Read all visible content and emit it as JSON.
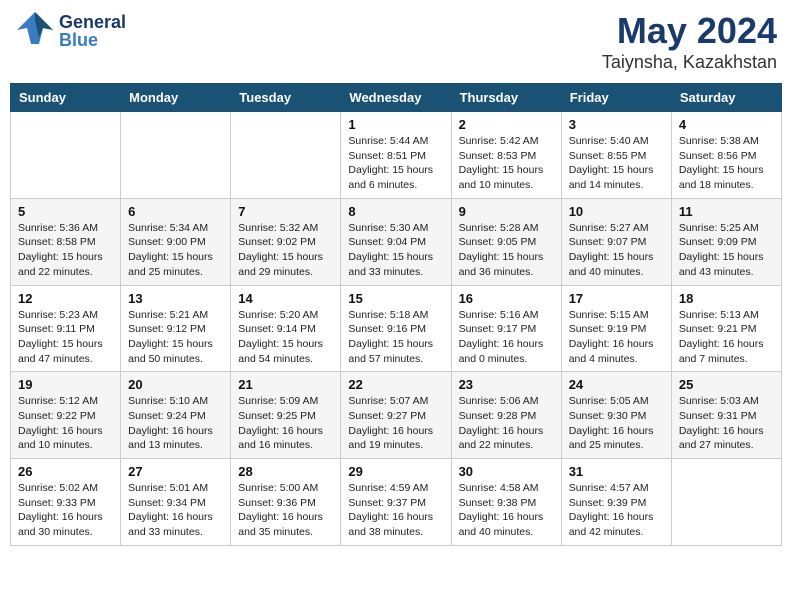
{
  "header": {
    "logo_general": "General",
    "logo_blue": "Blue",
    "month": "May 2024",
    "location": "Taiynsha, Kazakhstan"
  },
  "days_of_week": [
    "Sunday",
    "Monday",
    "Tuesday",
    "Wednesday",
    "Thursday",
    "Friday",
    "Saturday"
  ],
  "weeks": [
    [
      {
        "day": "",
        "sunrise": "",
        "sunset": "",
        "daylight": ""
      },
      {
        "day": "",
        "sunrise": "",
        "sunset": "",
        "daylight": ""
      },
      {
        "day": "",
        "sunrise": "",
        "sunset": "",
        "daylight": ""
      },
      {
        "day": "1",
        "sunrise": "Sunrise: 5:44 AM",
        "sunset": "Sunset: 8:51 PM",
        "daylight": "Daylight: 15 hours and 6 minutes."
      },
      {
        "day": "2",
        "sunrise": "Sunrise: 5:42 AM",
        "sunset": "Sunset: 8:53 PM",
        "daylight": "Daylight: 15 hours and 10 minutes."
      },
      {
        "day": "3",
        "sunrise": "Sunrise: 5:40 AM",
        "sunset": "Sunset: 8:55 PM",
        "daylight": "Daylight: 15 hours and 14 minutes."
      },
      {
        "day": "4",
        "sunrise": "Sunrise: 5:38 AM",
        "sunset": "Sunset: 8:56 PM",
        "daylight": "Daylight: 15 hours and 18 minutes."
      }
    ],
    [
      {
        "day": "5",
        "sunrise": "Sunrise: 5:36 AM",
        "sunset": "Sunset: 8:58 PM",
        "daylight": "Daylight: 15 hours and 22 minutes."
      },
      {
        "day": "6",
        "sunrise": "Sunrise: 5:34 AM",
        "sunset": "Sunset: 9:00 PM",
        "daylight": "Daylight: 15 hours and 25 minutes."
      },
      {
        "day": "7",
        "sunrise": "Sunrise: 5:32 AM",
        "sunset": "Sunset: 9:02 PM",
        "daylight": "Daylight: 15 hours and 29 minutes."
      },
      {
        "day": "8",
        "sunrise": "Sunrise: 5:30 AM",
        "sunset": "Sunset: 9:04 PM",
        "daylight": "Daylight: 15 hours and 33 minutes."
      },
      {
        "day": "9",
        "sunrise": "Sunrise: 5:28 AM",
        "sunset": "Sunset: 9:05 PM",
        "daylight": "Daylight: 15 hours and 36 minutes."
      },
      {
        "day": "10",
        "sunrise": "Sunrise: 5:27 AM",
        "sunset": "Sunset: 9:07 PM",
        "daylight": "Daylight: 15 hours and 40 minutes."
      },
      {
        "day": "11",
        "sunrise": "Sunrise: 5:25 AM",
        "sunset": "Sunset: 9:09 PM",
        "daylight": "Daylight: 15 hours and 43 minutes."
      }
    ],
    [
      {
        "day": "12",
        "sunrise": "Sunrise: 5:23 AM",
        "sunset": "Sunset: 9:11 PM",
        "daylight": "Daylight: 15 hours and 47 minutes."
      },
      {
        "day": "13",
        "sunrise": "Sunrise: 5:21 AM",
        "sunset": "Sunset: 9:12 PM",
        "daylight": "Daylight: 15 hours and 50 minutes."
      },
      {
        "day": "14",
        "sunrise": "Sunrise: 5:20 AM",
        "sunset": "Sunset: 9:14 PM",
        "daylight": "Daylight: 15 hours and 54 minutes."
      },
      {
        "day": "15",
        "sunrise": "Sunrise: 5:18 AM",
        "sunset": "Sunset: 9:16 PM",
        "daylight": "Daylight: 15 hours and 57 minutes."
      },
      {
        "day": "16",
        "sunrise": "Sunrise: 5:16 AM",
        "sunset": "Sunset: 9:17 PM",
        "daylight": "Daylight: 16 hours and 0 minutes."
      },
      {
        "day": "17",
        "sunrise": "Sunrise: 5:15 AM",
        "sunset": "Sunset: 9:19 PM",
        "daylight": "Daylight: 16 hours and 4 minutes."
      },
      {
        "day": "18",
        "sunrise": "Sunrise: 5:13 AM",
        "sunset": "Sunset: 9:21 PM",
        "daylight": "Daylight: 16 hours and 7 minutes."
      }
    ],
    [
      {
        "day": "19",
        "sunrise": "Sunrise: 5:12 AM",
        "sunset": "Sunset: 9:22 PM",
        "daylight": "Daylight: 16 hours and 10 minutes."
      },
      {
        "day": "20",
        "sunrise": "Sunrise: 5:10 AM",
        "sunset": "Sunset: 9:24 PM",
        "daylight": "Daylight: 16 hours and 13 minutes."
      },
      {
        "day": "21",
        "sunrise": "Sunrise: 5:09 AM",
        "sunset": "Sunset: 9:25 PM",
        "daylight": "Daylight: 16 hours and 16 minutes."
      },
      {
        "day": "22",
        "sunrise": "Sunrise: 5:07 AM",
        "sunset": "Sunset: 9:27 PM",
        "daylight": "Daylight: 16 hours and 19 minutes."
      },
      {
        "day": "23",
        "sunrise": "Sunrise: 5:06 AM",
        "sunset": "Sunset: 9:28 PM",
        "daylight": "Daylight: 16 hours and 22 minutes."
      },
      {
        "day": "24",
        "sunrise": "Sunrise: 5:05 AM",
        "sunset": "Sunset: 9:30 PM",
        "daylight": "Daylight: 16 hours and 25 minutes."
      },
      {
        "day": "25",
        "sunrise": "Sunrise: 5:03 AM",
        "sunset": "Sunset: 9:31 PM",
        "daylight": "Daylight: 16 hours and 27 minutes."
      }
    ],
    [
      {
        "day": "26",
        "sunrise": "Sunrise: 5:02 AM",
        "sunset": "Sunset: 9:33 PM",
        "daylight": "Daylight: 16 hours and 30 minutes."
      },
      {
        "day": "27",
        "sunrise": "Sunrise: 5:01 AM",
        "sunset": "Sunset: 9:34 PM",
        "daylight": "Daylight: 16 hours and 33 minutes."
      },
      {
        "day": "28",
        "sunrise": "Sunrise: 5:00 AM",
        "sunset": "Sunset: 9:36 PM",
        "daylight": "Daylight: 16 hours and 35 minutes."
      },
      {
        "day": "29",
        "sunrise": "Sunrise: 4:59 AM",
        "sunset": "Sunset: 9:37 PM",
        "daylight": "Daylight: 16 hours and 38 minutes."
      },
      {
        "day": "30",
        "sunrise": "Sunrise: 4:58 AM",
        "sunset": "Sunset: 9:38 PM",
        "daylight": "Daylight: 16 hours and 40 minutes."
      },
      {
        "day": "31",
        "sunrise": "Sunrise: 4:57 AM",
        "sunset": "Sunset: 9:39 PM",
        "daylight": "Daylight: 16 hours and 42 minutes."
      },
      {
        "day": "",
        "sunrise": "",
        "sunset": "",
        "daylight": ""
      }
    ]
  ]
}
